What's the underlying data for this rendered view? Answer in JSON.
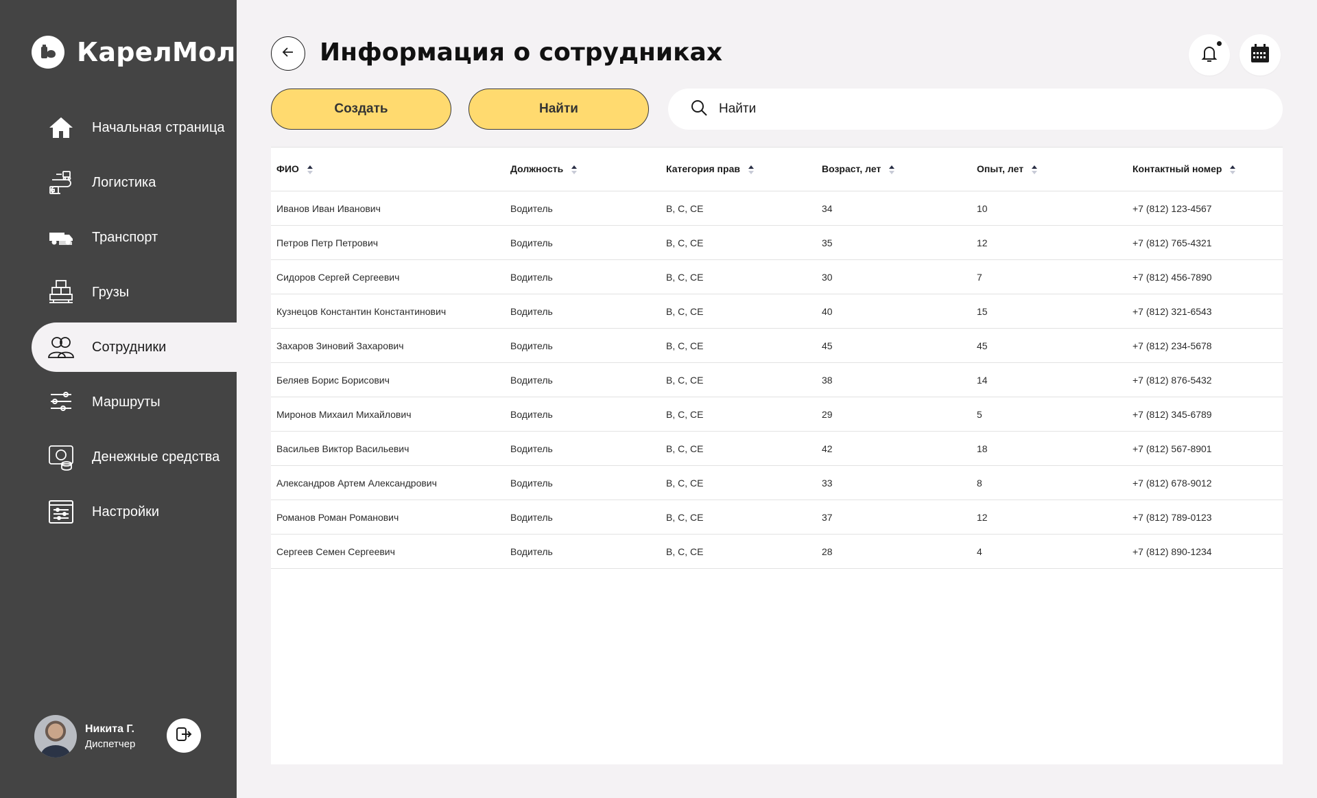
{
  "app": {
    "name": "КарелМол"
  },
  "sidebar": {
    "items": [
      {
        "label": "Начальная страница",
        "icon": "home-icon",
        "active": false
      },
      {
        "label": "Логистика",
        "icon": "logistics-icon",
        "active": false
      },
      {
        "label": "Транспорт",
        "icon": "truck-icon",
        "active": false
      },
      {
        "label": "Грузы",
        "icon": "cargo-icon",
        "active": false
      },
      {
        "label": "Сотрудники",
        "icon": "employees-icon",
        "active": true
      },
      {
        "label": "Маршруты",
        "icon": "routes-icon",
        "active": false
      },
      {
        "label": "Денежные средства",
        "icon": "money-icon",
        "active": false
      },
      {
        "label": "Настройки",
        "icon": "settings-icon",
        "active": false
      }
    ]
  },
  "user": {
    "name": "Никита Г.",
    "role": "Диспетчер"
  },
  "header": {
    "title": "Информация о сотрудниках"
  },
  "actions": {
    "create_label": "Создать",
    "find_label": "Найти",
    "search_placeholder": "Найти"
  },
  "table": {
    "columns": [
      "ФИО",
      "Должность",
      "Категория прав",
      "Возраст, лет",
      "Опыт, лет",
      "Контактный номер"
    ],
    "rows": [
      [
        "Иванов Иван Иванович",
        "Водитель",
        "B, C, CE",
        "34",
        "10",
        "+7 (812) 123-4567"
      ],
      [
        "Петров Петр Петрович",
        "Водитель",
        "B, C, CE",
        "35",
        "12",
        "+7 (812) 765-4321"
      ],
      [
        "Сидоров Сергей Сергеевич",
        "Водитель",
        "B, C, CE",
        "30",
        "7",
        "+7 (812) 456-7890"
      ],
      [
        "Кузнецов Константин Константинович",
        "Водитель",
        "B, C, CE",
        "40",
        "15",
        "+7 (812) 321-6543"
      ],
      [
        "Захаров Зиновий Захарович",
        "Водитель",
        "B, C, CE",
        "45",
        "45",
        "+7 (812) 234-5678"
      ],
      [
        "Беляев Борис Борисович",
        "Водитель",
        "B, C, CE",
        "38",
        "14",
        "+7 (812) 876-5432"
      ],
      [
        "Миронов Михаил Михайлович",
        "Водитель",
        "B, C, CE",
        "29",
        "5",
        "+7 (812) 345-6789"
      ],
      [
        "Васильев Виктор Васильевич",
        "Водитель",
        "B, C, CE",
        "42",
        "18",
        "+7 (812) 567-8901"
      ],
      [
        "Александров Артем Александрович",
        "Водитель",
        "B, C, CE",
        "33",
        "8",
        "+7 (812) 678-9012"
      ],
      [
        "Романов Роман Романович",
        "Водитель",
        "B, C, CE",
        "37",
        "12",
        "+7 (812) 789-0123"
      ],
      [
        "Сергеев Семен Сергеевич",
        "Водитель",
        "B, C, CE",
        "28",
        "4",
        "+7 (812) 890-1234"
      ]
    ]
  },
  "colors": {
    "sidebar_bg": "#444444",
    "page_bg": "#f4f2f4",
    "accent_yellow": "#ffda6f",
    "text_dark": "#1a1a1a"
  }
}
